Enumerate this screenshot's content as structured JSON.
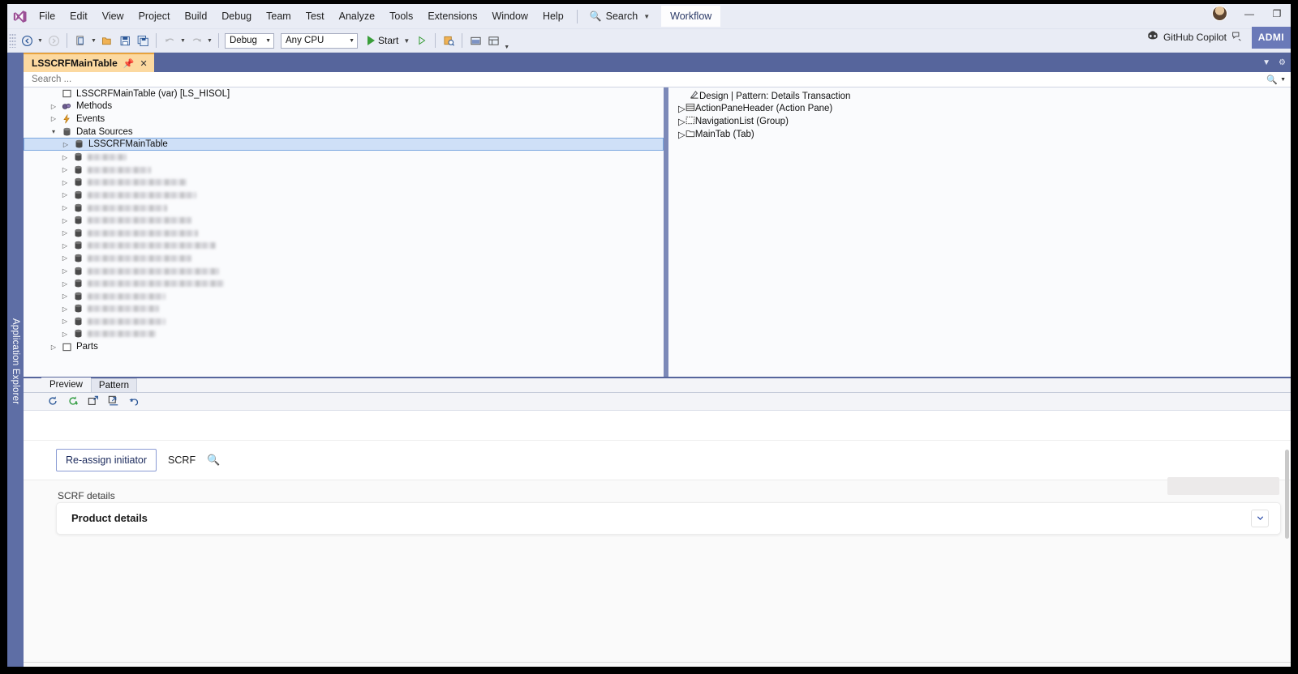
{
  "app": {
    "title": "Visual Studio",
    "logo_icon": "visual-studio-logo"
  },
  "menubar": {
    "items": [
      "File",
      "Edit",
      "View",
      "Project",
      "Build",
      "Debug",
      "Team",
      "Test",
      "Analyze",
      "Tools",
      "Extensions",
      "Window",
      "Help"
    ],
    "search_label": "Search",
    "search_icon": "magnifier-icon",
    "workflow_tab": "Workflow",
    "copilot_label": "GitHub Copilot",
    "copilot_icon": "github-copilot-icon",
    "copilot_extra_icon": "copilot-chat-icon",
    "admin_badge": "ADMI",
    "avatar_icon": "user-avatar",
    "minimize_icon": "minimize-icon",
    "maximize_icon": "restore-icon"
  },
  "toolbar": {
    "back_icon": "navigate-back-icon",
    "forward_icon": "navigate-forward-icon",
    "new_project_icon": "new-project-icon",
    "open_icon": "open-file-icon",
    "save_icon": "save-icon",
    "save_all_icon": "save-all-icon",
    "undo_icon": "undo-icon",
    "redo_icon": "redo-icon",
    "configuration": "Debug",
    "platform": "Any CPU",
    "start_label": "Start",
    "start_icon": "play-icon",
    "attach_icon": "play-outline-icon",
    "find_icon": "find-in-files-icon",
    "window_icon": "window-layout-icon",
    "toolbox_icon": "toolbox-icon",
    "overflow_icon": "toolbar-overflow-icon"
  },
  "left_dock": {
    "label": "Application Explorer"
  },
  "document_tab": {
    "title": "LSSCRFMainTable",
    "pin_icon": "pin-icon",
    "close_icon": "close-icon",
    "dropdown_icon": "tab-list-dropdown-icon",
    "settings_icon": "gear-icon"
  },
  "tree_search": {
    "placeholder": "Search ...",
    "value": "",
    "search_icon": "magnifier-icon",
    "dropdown_icon": "chevron-down-icon"
  },
  "tree": {
    "root": {
      "label": "LSSCRFMainTable (var) [LS_HISOL]",
      "icon": "table-node-icon"
    },
    "nodes": [
      {
        "label": "Methods",
        "icon": "methods-icon",
        "expanded": false,
        "indent": 1
      },
      {
        "label": "Events",
        "icon": "events-icon",
        "expanded": false,
        "indent": 1
      },
      {
        "label": "Data Sources",
        "icon": "datasource-icon",
        "expanded": true,
        "indent": 1
      }
    ],
    "selected_child": {
      "label": "LSSCRFMainTable",
      "icon": "datasource-icon"
    },
    "redacted_children_count": 16,
    "redacted_widths": [
      48,
      78,
      122,
      134,
      98,
      128,
      136,
      158,
      128,
      162,
      168,
      96,
      88,
      96,
      84
    ],
    "tail": {
      "label": "Parts",
      "icon": "parts-icon",
      "indent": 1
    }
  },
  "design_tree": {
    "header": {
      "label": "Design | Pattern: Details Transaction",
      "icon": "design-surface-icon"
    },
    "nodes": [
      {
        "label": "ActionPaneHeader (Action Pane)",
        "icon": "action-pane-icon"
      },
      {
        "label": "NavigationList (Group)",
        "icon": "group-icon"
      },
      {
        "label": "MainTab (Tab)",
        "icon": "tab-icon"
      }
    ]
  },
  "preview_panel": {
    "tabs": [
      {
        "label": "Preview",
        "active": true
      },
      {
        "label": "Pattern",
        "active": false
      }
    ],
    "toolbar_icons": [
      "refresh-icon",
      "refresh-add-icon",
      "open-in-new-window-icon",
      "import-icon",
      "undo-icon"
    ],
    "command_bar": {
      "button_label": "Re-assign initiator",
      "caption": "SCRF",
      "search_icon": "magnifier-icon"
    },
    "details_label": "SCRF details",
    "card": {
      "title": "Product details",
      "expand_icon": "chevron-down-icon"
    }
  }
}
